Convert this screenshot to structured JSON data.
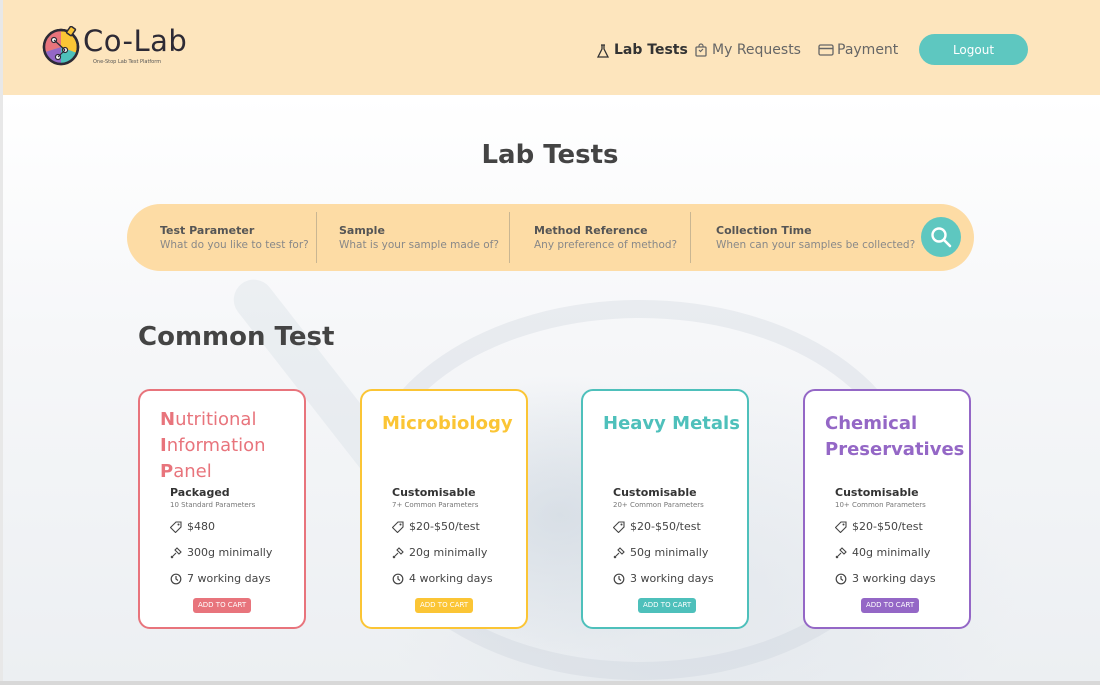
{
  "brand": {
    "name": "Co-Lab",
    "tagline": "One-Stop Lab Test Platform"
  },
  "nav": {
    "lab_tests": "Lab Tests",
    "my_requests": "My Requests",
    "payment": "Payment",
    "logout": "Logout"
  },
  "page_title": "Lab Tests",
  "search": {
    "fields": [
      {
        "title": "Test Parameter",
        "placeholder": "What do you like to test for?"
      },
      {
        "title": "Sample",
        "placeholder": "What is your sample made of?"
      },
      {
        "title": "Method Reference",
        "placeholder": "Any preference of method?"
      },
      {
        "title": "Collection Time",
        "placeholder": "When can your samples be collected?"
      }
    ]
  },
  "section_title": "Common Test",
  "cards": [
    {
      "title_lines": [
        {
          "first": "N",
          "rest": "utritional"
        },
        {
          "first": "I",
          "rest": "nformation"
        },
        {
          "first": "P",
          "rest": "anel"
        }
      ],
      "type": "Packaged",
      "params": "10 Standard Parameters",
      "price": "$480",
      "sample": "300g minimally",
      "time": "7 working days",
      "cart": "ADD TO CART",
      "color": "#e8747c"
    },
    {
      "title": "Microbiology",
      "type": "Customisable",
      "params": "7+ Common Parameters",
      "price": "$20-$50/test",
      "sample": "20g minimally",
      "time": "4 working days",
      "cart": "ADD TO CART",
      "color": "#fbc535"
    },
    {
      "title": "Heavy Metals",
      "type": "Customisable",
      "params": "20+ Common Parameters",
      "price": "$20-$50/test",
      "sample": "50g minimally",
      "time": "3 working days",
      "cart": "ADD TO CART",
      "color": "#4ec0bb"
    },
    {
      "title_a": "Chemical",
      "title_b": "Preservatives",
      "type": "Customisable",
      "params": "10+ Common Parameters",
      "price": "$20-$50/test",
      "sample": "40g minimally",
      "time": "3 working days",
      "cart": "ADD TO CART",
      "color": "#9467c6"
    }
  ],
  "icons": {
    "tag": "price-tag-icon",
    "sample": "dropper-icon",
    "time": "clock-icon"
  }
}
